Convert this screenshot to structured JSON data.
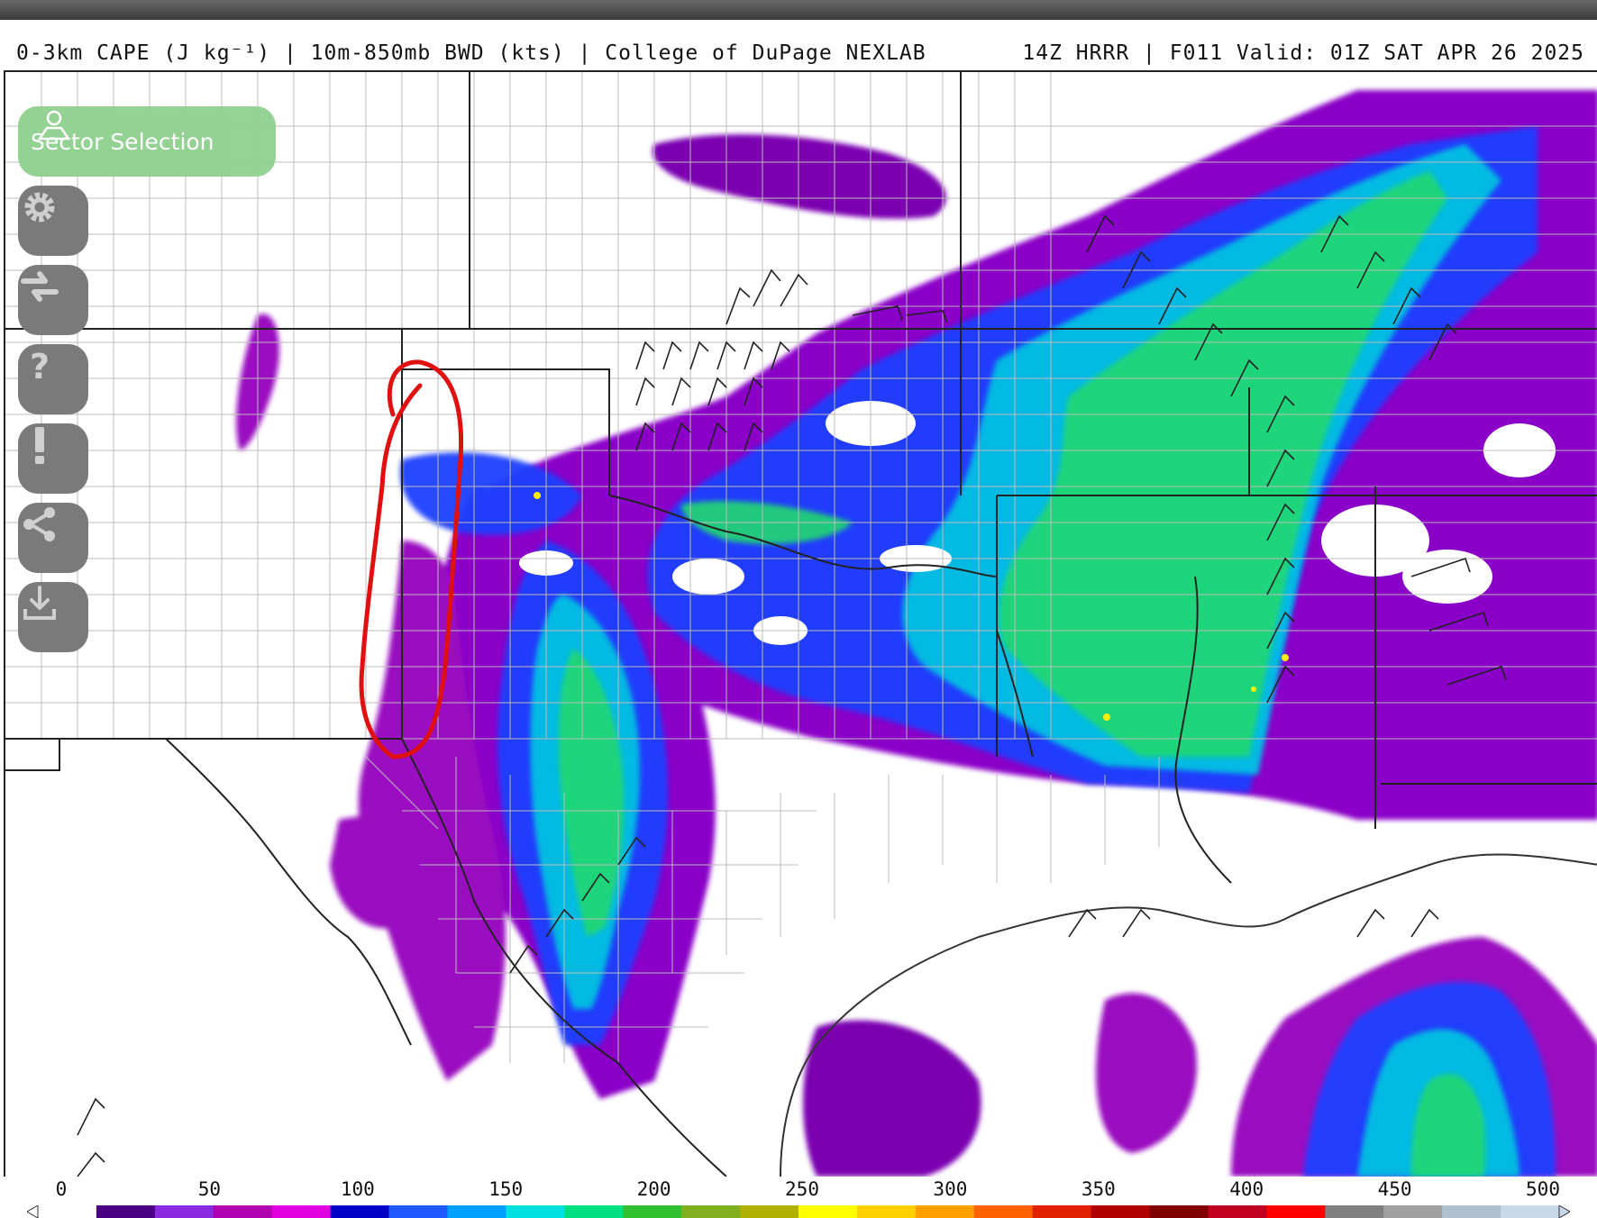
{
  "header": {
    "title_left": "0-3km CAPE (J kg⁻¹) | 10m-850mb BWD (kts) | College of DuPage NEXLAB",
    "title_right": "14Z HRRR | F011 Valid: 01Z SAT APR 26 2025"
  },
  "controls": {
    "sector_selection_label": "Sector Selection",
    "buttons": [
      {
        "icon": "gear-icon",
        "name": "settings-button"
      },
      {
        "icon": "swap-arrows-icon",
        "name": "compare-button"
      },
      {
        "icon": "question-icon",
        "name": "help-button"
      },
      {
        "icon": "exclamation-icon",
        "name": "alert-button"
      },
      {
        "icon": "share-icon",
        "name": "share-button"
      },
      {
        "icon": "download-icon",
        "name": "download-button"
      }
    ]
  },
  "legend": {
    "tick_labels": [
      "0",
      "50",
      "100",
      "150",
      "200",
      "250",
      "300",
      "350",
      "400",
      "450",
      "500"
    ],
    "colors": [
      "#ffffff",
      "#4b0082",
      "#8a2be2",
      "#b000b0",
      "#e000e0",
      "#0000c8",
      "#1e5aff",
      "#00a0ff",
      "#00e0e0",
      "#00e080",
      "#30c030",
      "#80b020",
      "#b0b000",
      "#ffff00",
      "#ffd000",
      "#ffa000",
      "#ff6000",
      "#e02000",
      "#b00000",
      "#800000",
      "#c00020",
      "#ff0000",
      "#808080",
      "#a0a0a0",
      "#b0c0d0",
      "#c8d8e8"
    ]
  },
  "annotation": {
    "color": "#e01010"
  }
}
